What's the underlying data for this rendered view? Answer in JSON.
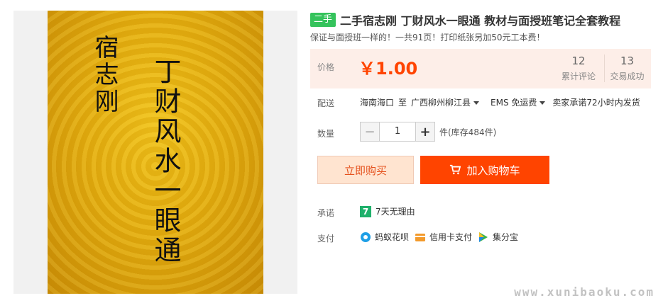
{
  "product": {
    "badge": "二手",
    "title": "二手宿志刚 丁财风水一眼通 教材与面授班笔记全套教程",
    "subtitle": "保证与面授班一样的！一共91页！打印纸张另加50元工本费！",
    "cover": {
      "author": "宿志刚",
      "title": "丁财风水一眼通"
    }
  },
  "price": {
    "label": "价格",
    "value": "￥1.00",
    "reviews_count": "12",
    "reviews_label": "累计评论",
    "sales_count": "13",
    "sales_label": "交易成功"
  },
  "shipping": {
    "label": "配送",
    "from": "海南海口",
    "to_word": "至",
    "to": "广西柳州柳江县",
    "method": "EMS 免运费",
    "promise": "卖家承诺72小时内发货"
  },
  "quantity": {
    "label": "数量",
    "minus": "−",
    "value": "1",
    "plus": "+",
    "stock": "件(库存484件)"
  },
  "actions": {
    "buy_now": "立即购买",
    "add_to_cart": "加入购物车"
  },
  "guarantee": {
    "label": "承诺",
    "icon_char": "7",
    "text": "7天无理由"
  },
  "payment": {
    "label": "支付",
    "methods": [
      {
        "name": "蚂蚁花呗",
        "icon": "huabei-icon"
      },
      {
        "name": "信用卡支付",
        "icon": "credit-card-icon"
      },
      {
        "name": "集分宝",
        "icon": "jifenbao-icon"
      }
    ]
  },
  "colors": {
    "accent": "#ff4400",
    "price_bg": "#fdeee8",
    "badge": "#35c35c"
  },
  "watermark": "www.xunibaoku.com"
}
